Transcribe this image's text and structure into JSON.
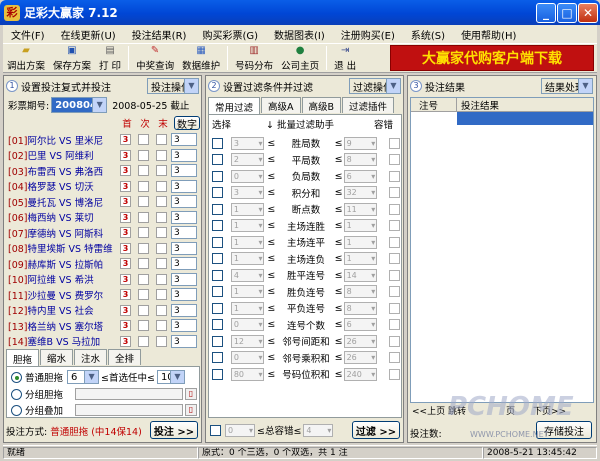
{
  "window": {
    "title": "足彩大赢家 7.12",
    "min": "_",
    "max": "□",
    "close": "✕"
  },
  "menu": [
    "文件(F)",
    "在线更新(U)",
    "投注结果(R)",
    "购买彩票(G)",
    "数据图表(I)",
    "注册购买(E)",
    "系统(S)",
    "使用帮助(H)"
  ],
  "toolbar": {
    "buttons": [
      {
        "label": "调出方案",
        "icon": "folder-icon"
      },
      {
        "label": "保存方案",
        "icon": "save-icon"
      },
      {
        "label": "打 印",
        "icon": "printer-icon"
      },
      {
        "label": "中奖查询",
        "icon": "query-icon"
      },
      {
        "label": "数据维护",
        "icon": "database-icon"
      },
      {
        "label": "号码分布",
        "icon": "chart-icon"
      },
      {
        "label": "公司主页",
        "icon": "globe-icon"
      },
      {
        "label": "退 出",
        "icon": "exit-icon"
      }
    ],
    "banner": "大赢家代购客户端下载"
  },
  "left": {
    "header": "设置投注复式并投注",
    "op_button": "投注操作",
    "period_label": "彩票期号:",
    "period_value": "2008040",
    "date": "2008-05-25  截止",
    "col_headers": [
      "首",
      "次",
      "末"
    ],
    "num_button": "数字",
    "matches": [
      {
        "no": "[01]",
        "home": "阿尔比",
        "away": "里米尼",
        "mark": "3",
        "value": "3"
      },
      {
        "no": "[02]",
        "home": "巴里",
        "away": "阿维利",
        "mark": "3",
        "value": "3"
      },
      {
        "no": "[03]",
        "home": "布雷西",
        "away": "弗洛西",
        "mark": "3",
        "value": "3"
      },
      {
        "no": "[04]",
        "home": "格罗瑟",
        "away": "切沃",
        "mark": "3",
        "value": "3"
      },
      {
        "no": "[05]",
        "home": "曼托瓦",
        "away": "博洛尼",
        "mark": "3",
        "value": "3"
      },
      {
        "no": "[06]",
        "home": "梅西纳",
        "away": "莱切",
        "mark": "3",
        "value": "3"
      },
      {
        "no": "[07]",
        "home": "摩德纳",
        "away": "阿斯科",
        "mark": "3",
        "value": "3"
      },
      {
        "no": "[08]",
        "home": "特里埃斯",
        "away": "特雷维",
        "mark": "3",
        "value": "3"
      },
      {
        "no": "[09]",
        "home": "赫库斯",
        "away": "拉斯帕",
        "mark": "3",
        "value": "3"
      },
      {
        "no": "[10]",
        "home": "阿拉维",
        "away": "希洪",
        "mark": "3",
        "value": "3"
      },
      {
        "no": "[11]",
        "home": "沙拉曼",
        "away": "费罗尔",
        "mark": "3",
        "value": "3"
      },
      {
        "no": "[12]",
        "home": "特内里",
        "away": "社会",
        "mark": "3",
        "value": "3"
      },
      {
        "no": "[13]",
        "home": "格兰纳",
        "away": "塞尔塔",
        "mark": "3",
        "value": "3"
      },
      {
        "no": "[14]",
        "home": "塞维B",
        "away": "马拉加",
        "mark": "3",
        "value": "3"
      }
    ],
    "tabs": [
      "胆拖",
      "缩水",
      "注水",
      "全排"
    ],
    "radio1": "普通胆拖",
    "dan_count": "6",
    "dan_mid": "≤首选任中≤",
    "dan_max": "10",
    "radio2": "分组胆拖",
    "radio3": "分组叠加",
    "mode_label": "投注方式:",
    "mode_value": "普通胆拖 (中14保14)",
    "bet_button": "投注 >>"
  },
  "middle": {
    "header": "设置过滤条件并过滤",
    "op_button": "过滤操作",
    "tabs": [
      "常用过滤",
      "高级A",
      "高级B",
      "过滤插件"
    ],
    "col_select": "选择",
    "col_helper": "批量过滤助手",
    "col_tolerance": "容错",
    "rows": [
      {
        "min": "3",
        "label": "胜局数",
        "max": "9"
      },
      {
        "min": "2",
        "label": "平局数",
        "max": "8"
      },
      {
        "min": "0",
        "label": "负局数",
        "max": "6"
      },
      {
        "min": "3",
        "label": "积分和",
        "max": "32"
      },
      {
        "min": "1",
        "label": "断点数",
        "max": "11"
      },
      {
        "min": "1",
        "label": "主场连胜",
        "max": "1"
      },
      {
        "min": "1",
        "label": "主场连平",
        "max": "1"
      },
      {
        "min": "1",
        "label": "主场连负",
        "max": "1"
      },
      {
        "min": "4",
        "label": "胜平连号",
        "max": "14"
      },
      {
        "min": "1",
        "label": "胜负连号",
        "max": "8"
      },
      {
        "min": "1",
        "label": "平负连号",
        "max": "8"
      },
      {
        "min": "0",
        "label": "连号个数",
        "max": "6"
      },
      {
        "min": "12",
        "label": "邻号间距和",
        "max": "26"
      },
      {
        "min": "0",
        "label": "邻号乘积和",
        "max": "26"
      },
      {
        "min": "80",
        "label": "号码位积和",
        "max": "240"
      }
    ],
    "footer_min": "0",
    "footer_label": "≤总容错≤",
    "footer_max": "4",
    "filter_button": "过滤 >>"
  },
  "right": {
    "header": "投注结果",
    "op_button": "结果处理",
    "col_no": "注号",
    "col_result": "投注结果",
    "nav": "<<上页  跳转",
    "nav2": "页",
    "nav3": "下页>>",
    "count_label": "投注数:",
    "save_button": "存储投注"
  },
  "status": {
    "ready": "就绪",
    "info": "原式：0 个三选，0 个双选，共 1 注",
    "time": "2008-5-21  13:45:42"
  },
  "watermark": "PCHOME",
  "watermark_url": "WWW.PCHOME.NET"
}
